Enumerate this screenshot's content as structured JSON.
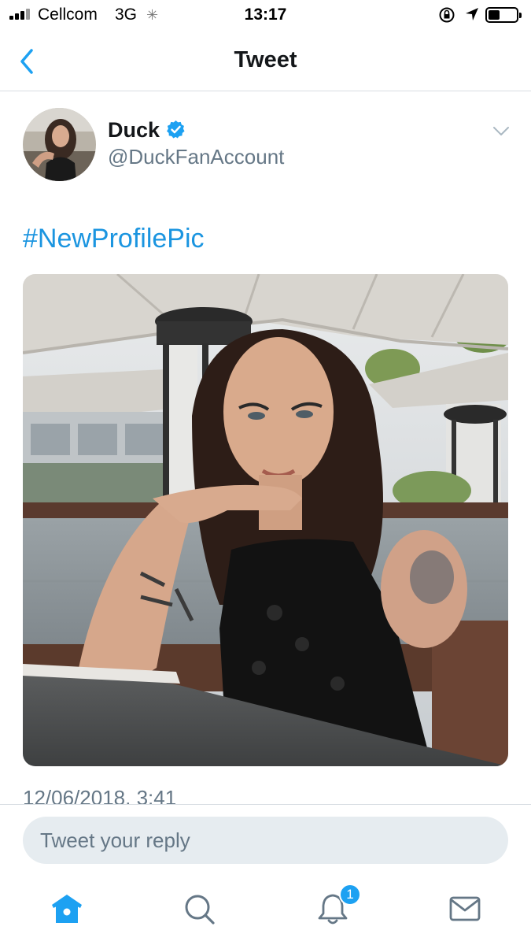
{
  "status_bar": {
    "carrier": "Cellcom",
    "network": "3G",
    "time": "13:17"
  },
  "nav": {
    "title": "Tweet",
    "back_icon": "chevron-left-icon"
  },
  "tweet": {
    "display_name": "Duck",
    "handle": "@DuckFanAccount",
    "verified": true,
    "text": "#NewProfilePic",
    "timestamp": "12/06/2018, 3:41",
    "media_description": "photo"
  },
  "reply": {
    "placeholder": "Tweet your reply"
  },
  "tab_bar": {
    "items": [
      "home-icon",
      "search-icon",
      "notifications-icon",
      "messages-icon"
    ],
    "notifications_badge": "1"
  },
  "colors": {
    "accent": "#1da1f2",
    "link": "#1b95e0",
    "secondary_text": "#657786",
    "reply_bg": "#e6ecf0"
  }
}
